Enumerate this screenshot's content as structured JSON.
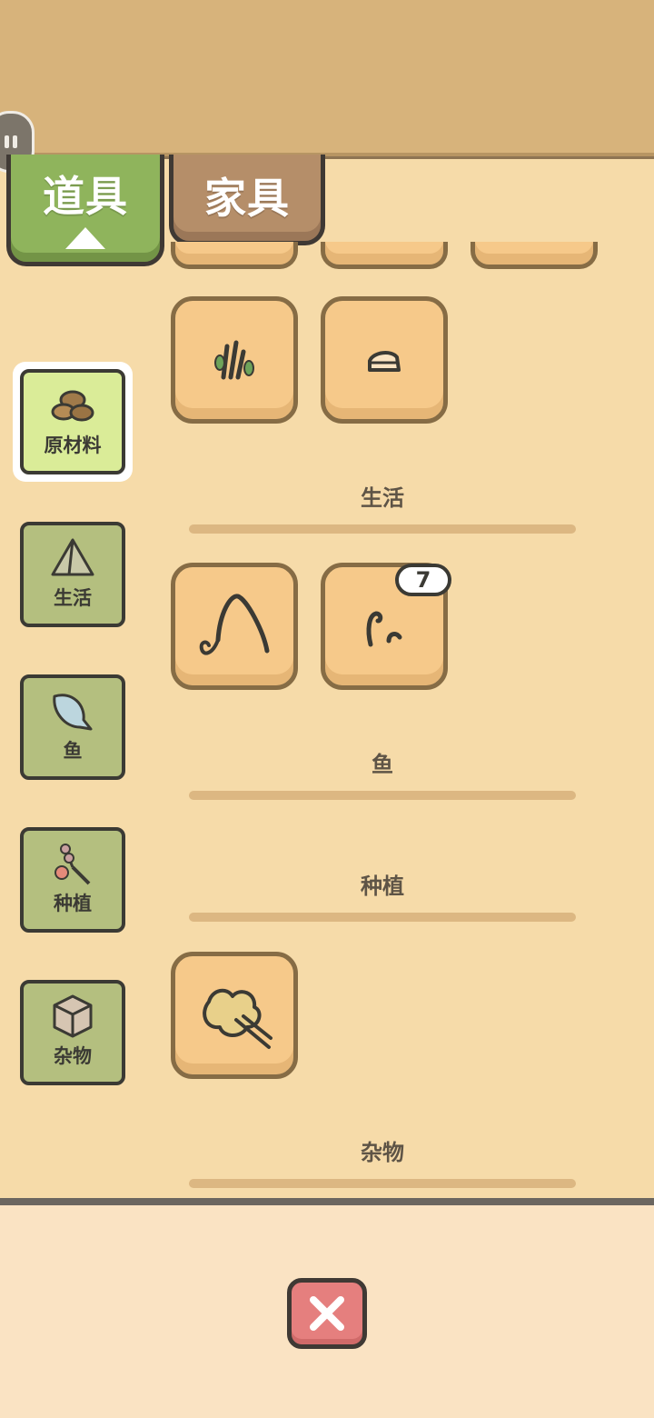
{
  "tabs": [
    {
      "label": "道具",
      "active": true
    },
    {
      "label": "家具",
      "active": false
    }
  ],
  "categories": [
    {
      "label": "原材料",
      "icon": "nuts-icon",
      "active": true
    },
    {
      "label": "生活",
      "icon": "tent-icon",
      "active": false
    },
    {
      "label": "鱼",
      "icon": "fish-icon",
      "active": false
    },
    {
      "label": "种植",
      "icon": "plant-icon",
      "active": false
    },
    {
      "label": "杂物",
      "icon": "box-icon",
      "active": false
    }
  ],
  "sections": [
    {
      "title": "生活"
    },
    {
      "title": "鱼"
    },
    {
      "title": "种植"
    },
    {
      "title": "杂物"
    }
  ],
  "items": {
    "raw_materials": [
      {
        "icon": "grass-sprout-icon"
      },
      {
        "icon": "cake-slice-icon"
      }
    ],
    "life": [
      {
        "icon": "fishing-rod-icon"
      },
      {
        "icon": "worm-bait-icon",
        "count": "7"
      }
    ],
    "misc": [
      {
        "icon": "flower-bouquet-icon"
      }
    ]
  },
  "colors": {
    "active_tab": "#8fb45c",
    "inactive_tab": "#b58e69",
    "close_button": "#e57f7e"
  }
}
